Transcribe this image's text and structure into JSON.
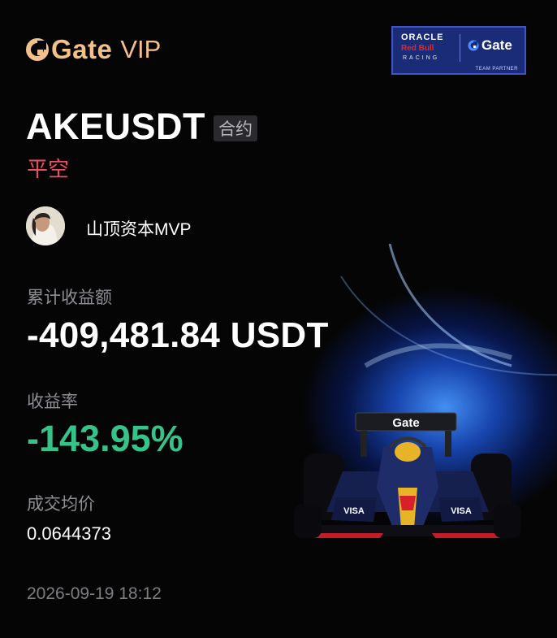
{
  "brand": {
    "name": "Gate",
    "tier": "VIP",
    "accent_color": "#f3c08a"
  },
  "partner_badge": {
    "line1": "ORACLE",
    "line2": "Red Bull",
    "line3": "RACING",
    "partner_name": "Gate",
    "caption": "TEAM PARTNER"
  },
  "position": {
    "symbol": "AKEUSDT",
    "contract_tag": "合约",
    "side": "平空",
    "side_color": "#ea4d66"
  },
  "user": {
    "name": "山顶资本MVP",
    "avatar_icon": "user-avatar"
  },
  "stats": {
    "pnl_label": "累计收益额",
    "pnl_value": "-409,481.84 USDT",
    "rate_label": "收益率",
    "rate_value": "-143.95%",
    "rate_color": "#35c38a",
    "avg_label": "成交均价",
    "avg_value": "0.0644373"
  },
  "timestamp": "2026-09-19 18:12",
  "car_art": {
    "wing_text": "Gate",
    "sidepod_text": "VISA"
  }
}
